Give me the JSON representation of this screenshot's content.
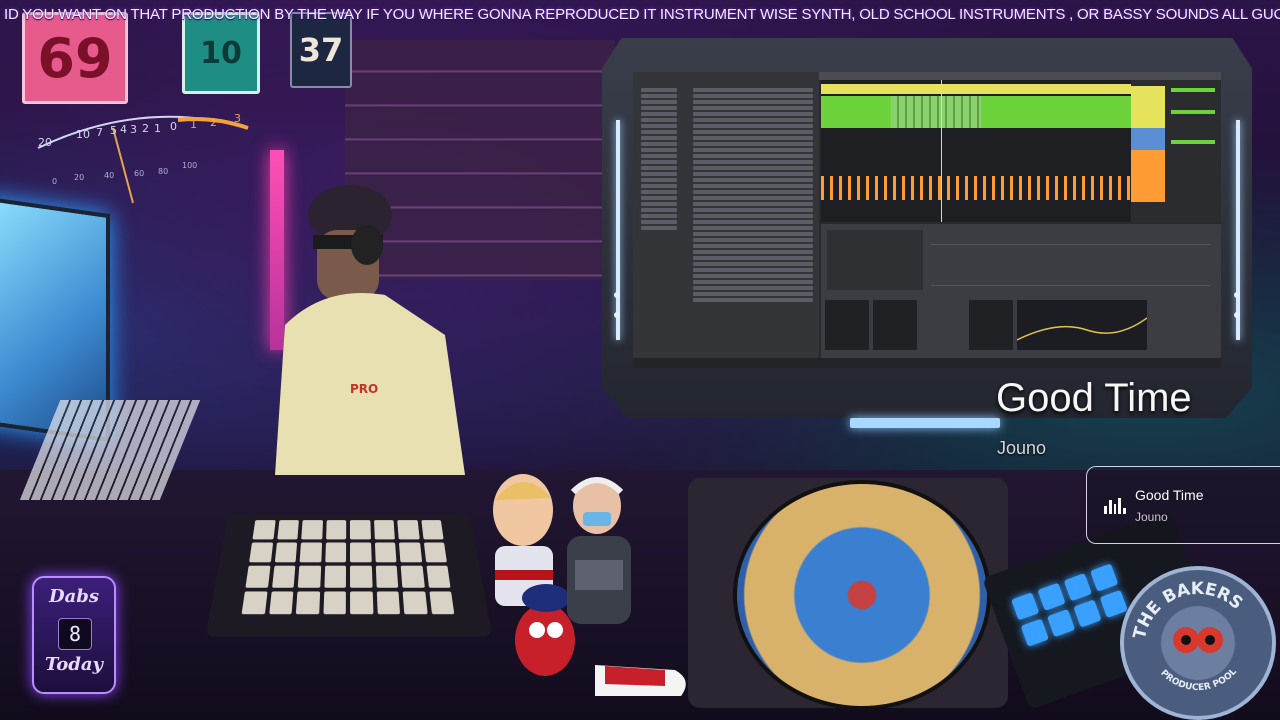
{
  "ticker": {
    "text": "ID YOU WANT ON THAT PRODUCTION BY THE WAY IF YOU WHERE GONNA REPRODUCED IT INSTRUMENT WISE SYNTH, OLD SCHOOL INSTRUMENTS , OR BASSY SOUNDS ALL GUCCI"
  },
  "jerseys": {
    "left": "69",
    "middle": "10",
    "right": "37"
  },
  "vu_meter": {
    "scale_top": [
      "20",
      "10",
      "7",
      "5",
      "4",
      "3",
      "2",
      "1",
      "0",
      "1",
      "2",
      "3"
    ],
    "scale_bottom": [
      "0",
      "20",
      "40",
      "60",
      "80",
      "100"
    ]
  },
  "now_playing": {
    "title": "Good Time",
    "artist": "Jouno"
  },
  "now_playing_card": {
    "title": "Good Time",
    "artist": "Jouno"
  },
  "dabs_badge": {
    "top_label": "Dabs",
    "count": "8",
    "bottom_label": "Today"
  },
  "bakers_logo": {
    "top_text": "THE BAKERS",
    "bottom_text": "PRODUCER POOL"
  },
  "colors": {
    "ticker_glow": "#7a2bd9",
    "accent_purple": "#8a45ff",
    "screen_green": "#6cd33a",
    "screen_yellow": "#e7e25b",
    "clip_orange": "#ff9c33",
    "clip_blue": "#5a8fd6"
  }
}
